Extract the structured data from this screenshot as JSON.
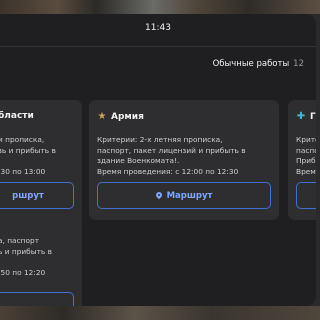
{
  "status_bar": {
    "time": "11:43"
  },
  "section": {
    "title": "Обычные работы",
    "count": "12"
  },
  "cards": [
    {
      "title": "бласти",
      "icon": "unknown-icon",
      "description": "и прописка,\nзь и прибыть в\n\n:30 по 13:00",
      "button": "ршрут"
    },
    {
      "title": "Армия",
      "icon": "star-icon",
      "icon_color": "#c9a24a",
      "description": "Критерии: 2-х летняя прописка,\nпаспорт, пакет лицензий и прибыть в\nздание Военкомата!.\nВремя проведения: с 12:00 по 12:30",
      "button": "Маршрут"
    },
    {
      "title": "Го",
      "icon": "plus-icon",
      "icon_color": "#3fb6d8",
      "description": "Крите\nпаспо\nПрибы\nВремя",
      "button": ""
    },
    {
      "title": "",
      "description": "а, паспорт\nь и прибыть в\n\n:50 по 12:20",
      "button": ""
    }
  ],
  "colors": {
    "accent": "#3f6fd1",
    "panel": "#1f1f21",
    "card": "#2e2e30"
  }
}
